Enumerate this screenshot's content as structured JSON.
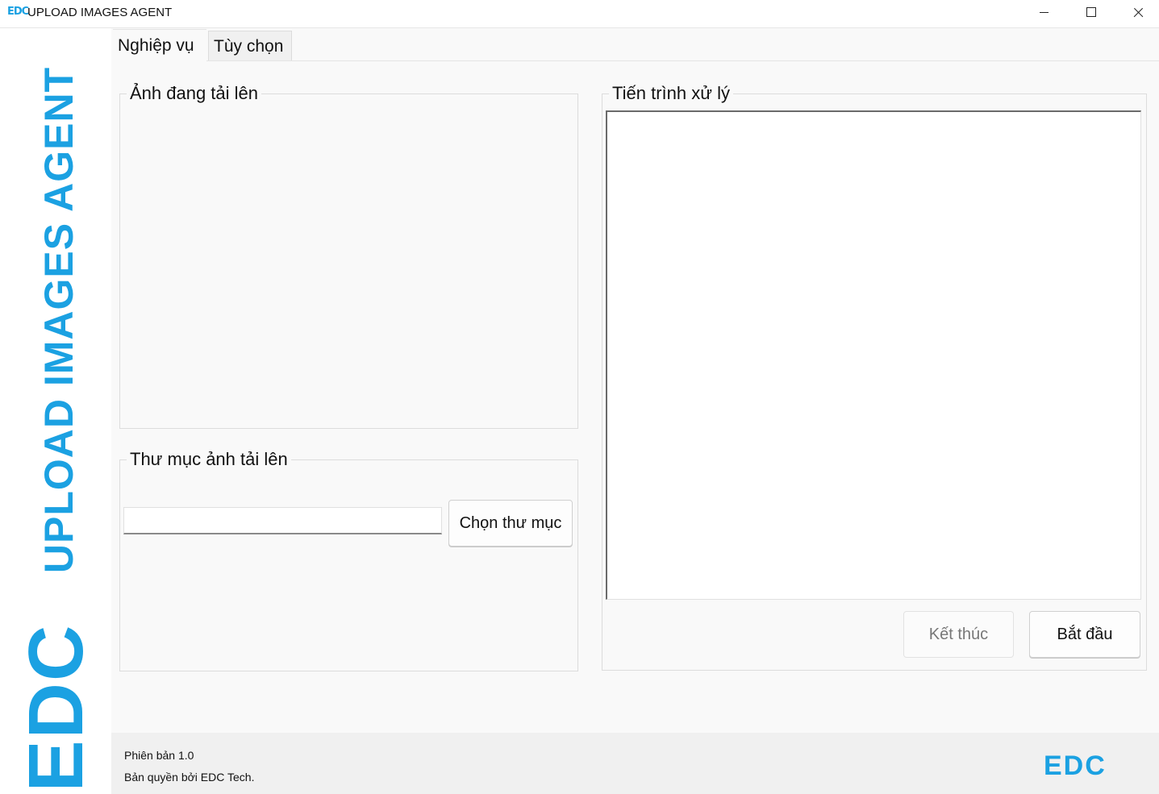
{
  "window": {
    "icon_text": "EDC",
    "title": "UPLOAD IMAGES AGENT"
  },
  "brand": {
    "vertical_title": "UPLOAD IMAGES AGENT",
    "logo_text": "EDC",
    "color": "#1ba1e2"
  },
  "tabs": [
    {
      "label": "Nghiệp vụ",
      "active": true
    },
    {
      "label": "Tùy chọn",
      "active": false
    }
  ],
  "images_group": {
    "legend": "Ảnh đang tải lên"
  },
  "folder_group": {
    "legend": "Thư mục ảnh tải lên",
    "input_value": "",
    "choose_button": "Chọn thư mục"
  },
  "progress_group": {
    "legend": "Tiến trình xử lý",
    "log_text": "",
    "stop_button": "Kết thúc",
    "start_button": "Bắt đầu"
  },
  "footer": {
    "version": "Phiên bản 1.0",
    "copyright": "Bản quyền bởi EDC Tech.",
    "logo_text": "EDC"
  }
}
